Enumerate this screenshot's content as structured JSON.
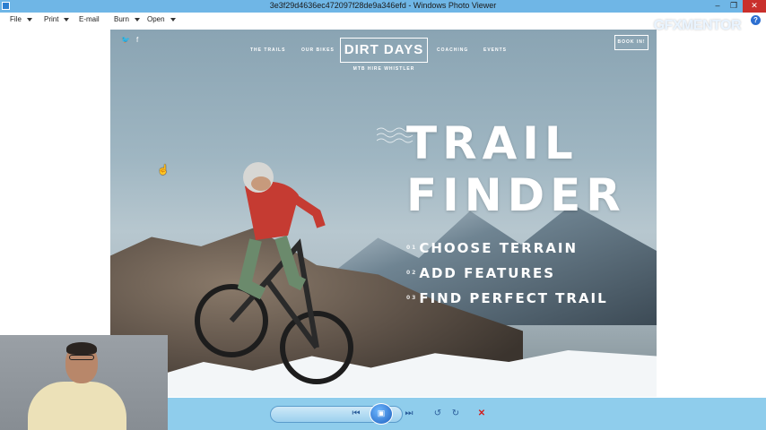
{
  "window": {
    "title": "3e3f29d4636ec472097f28de9a346efd - Windows Photo Viewer",
    "minimize": "–",
    "restore": "❐",
    "close": "✕"
  },
  "menu": {
    "items": [
      {
        "label": "File"
      },
      {
        "label": "Print"
      },
      {
        "label": "E-mail"
      },
      {
        "label": "Burn"
      },
      {
        "label": "Open"
      }
    ],
    "help": "?"
  },
  "watermark": "GFXMENTOR",
  "photo": {
    "social": [
      "🐦",
      "f"
    ],
    "nav_left": [
      "THE TRAILS",
      "OUR BIKES"
    ],
    "nav_right": [
      "COACHING",
      "EVENTS"
    ],
    "logo": "DIRT DAYS",
    "logo_sub": "MTB HIRE WHISTLER",
    "book_button": "BOOK IN!",
    "hero_line1": "TRAIL",
    "hero_line2": "FINDER",
    "steps": [
      {
        "num": "01",
        "text": "CHOOSE TERRAIN"
      },
      {
        "num": "02",
        "text": "ADD FEATURES"
      },
      {
        "num": "03",
        "text": "FIND PERFECT TRAIL"
      }
    ]
  },
  "toolbar": {
    "zoom_icon": "zoom-icon",
    "fit_icon": "actual-size-icon",
    "prev_icon": "previous-icon",
    "slideshow_icon": "slideshow-icon",
    "next_icon": "next-icon",
    "rotate_ccw_icon": "rotate-counterclockwise-icon",
    "rotate_cw_icon": "rotate-clockwise-icon",
    "delete_icon": "delete-icon"
  }
}
